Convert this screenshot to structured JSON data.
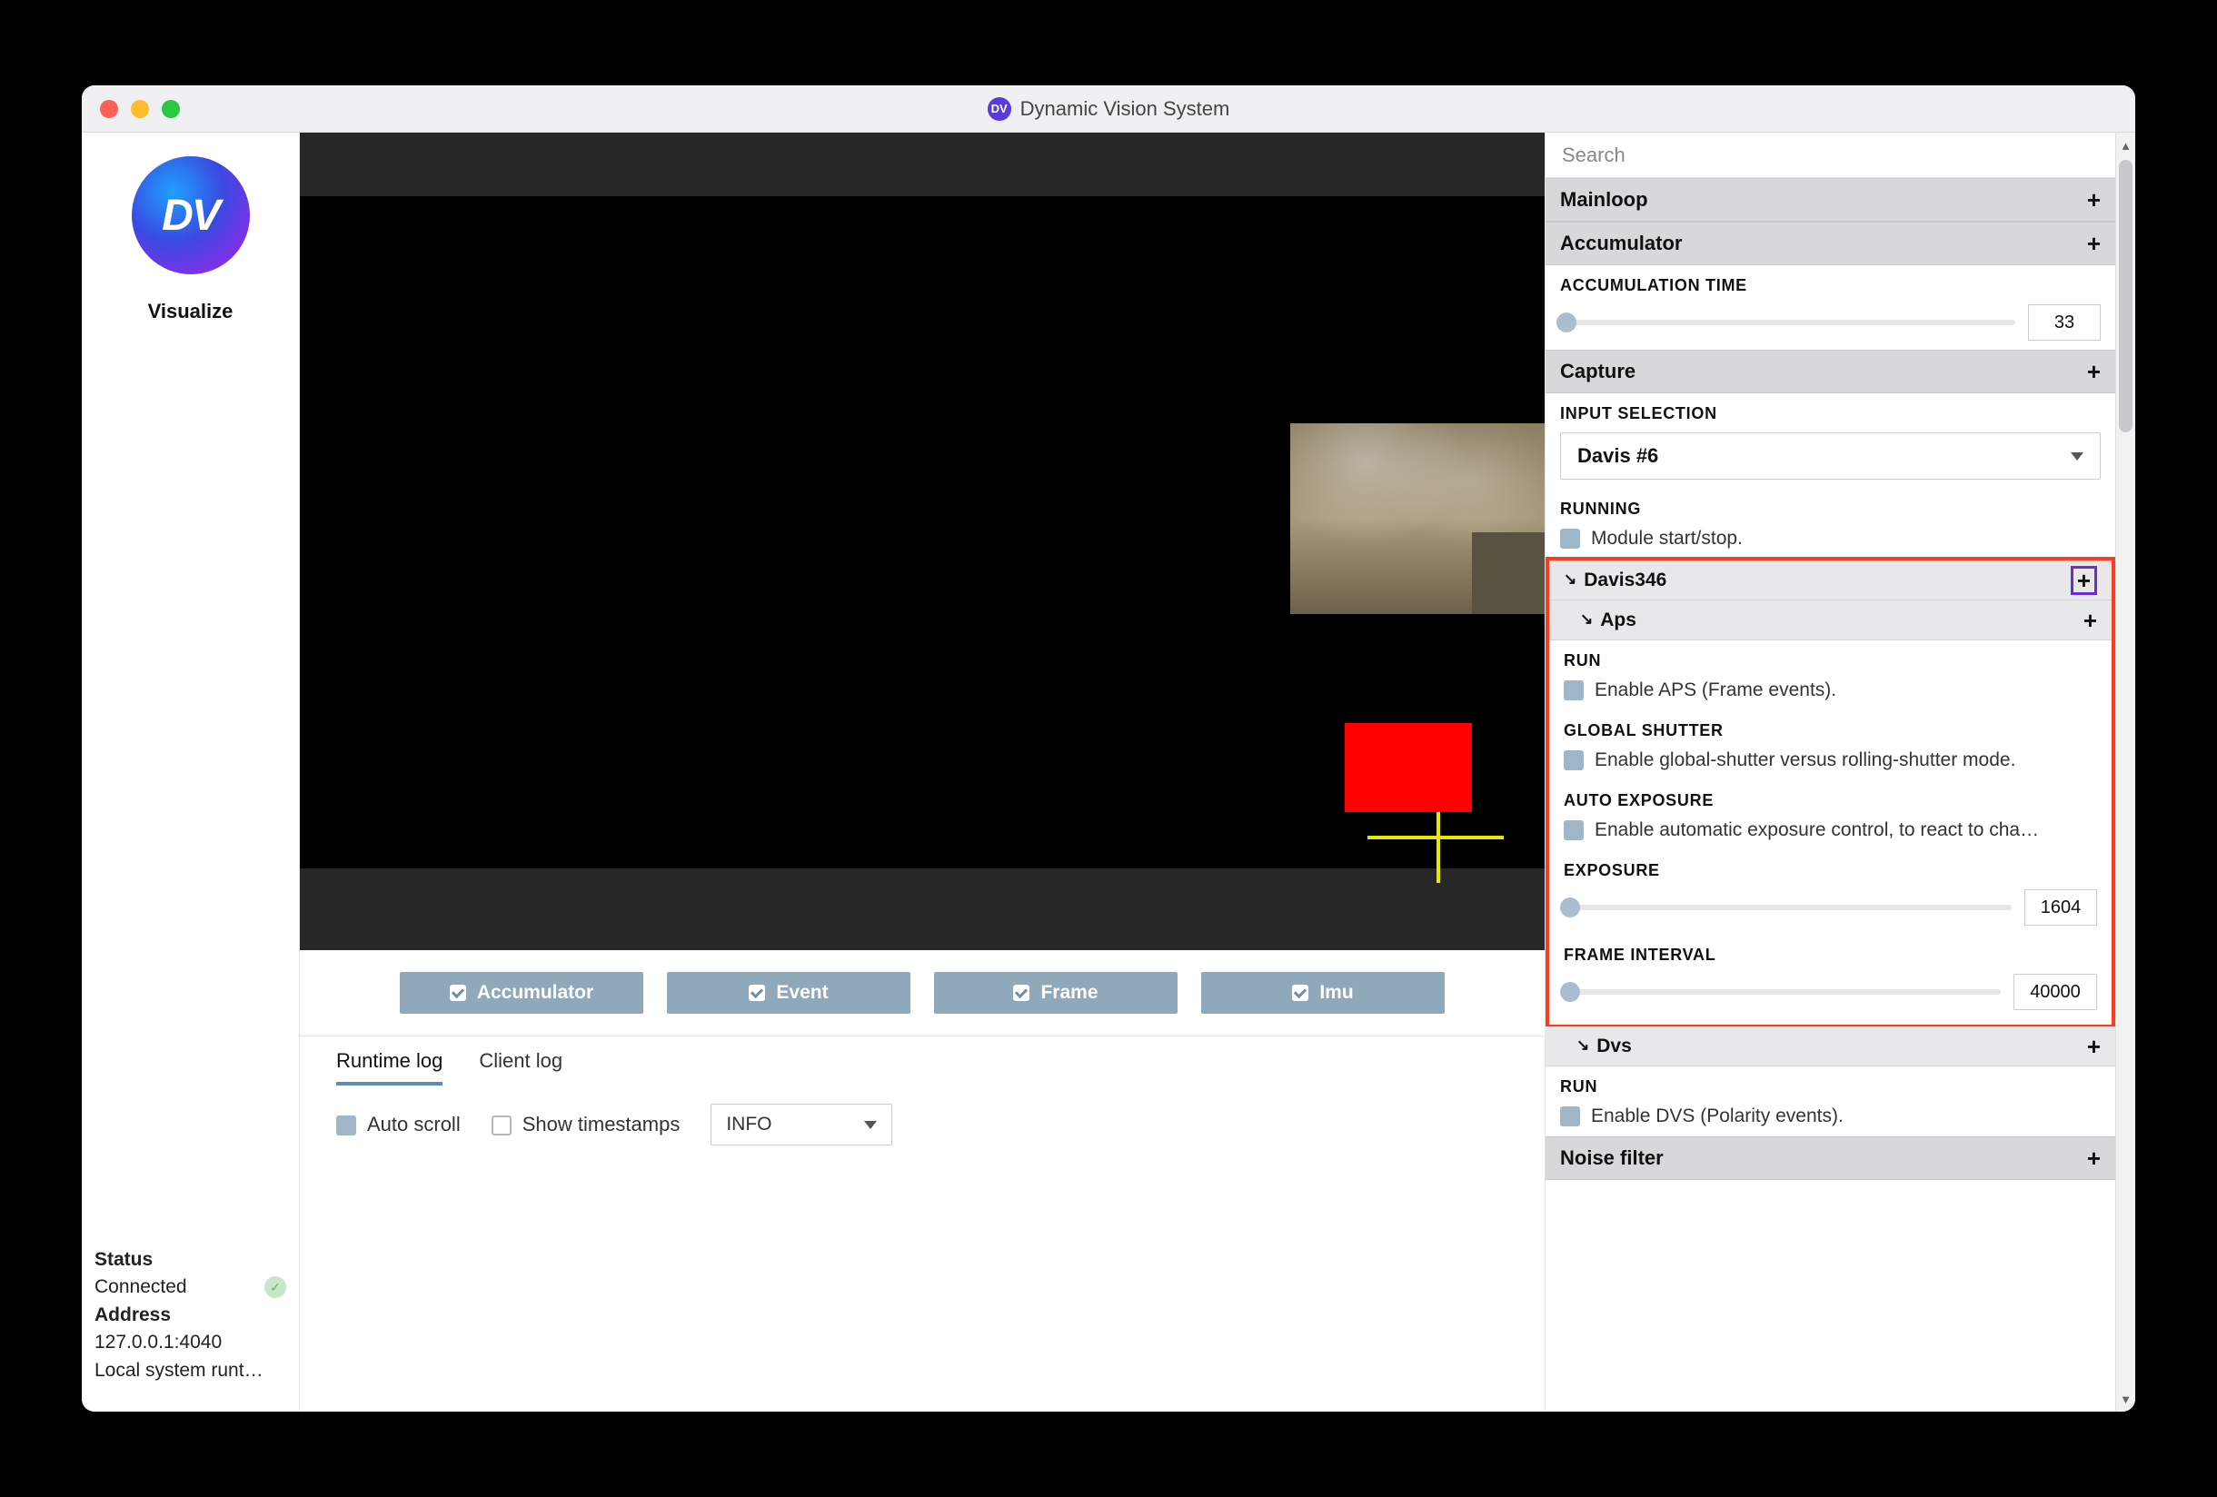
{
  "window": {
    "title": "Dynamic Vision System",
    "icon_text": "DV"
  },
  "left": {
    "logo_text": "DV",
    "visualize_label": "Visualize",
    "status_heading": "Status",
    "status_value": "Connected",
    "address_heading": "Address",
    "address_value": "127.0.0.1:4040",
    "system_line": "Local system runt…"
  },
  "tabs": {
    "accumulator": "Accumulator",
    "event": "Event",
    "frame": "Frame",
    "imu": "Imu"
  },
  "log": {
    "tab_runtime": "Runtime log",
    "tab_client": "Client log",
    "autoscroll": "Auto scroll",
    "show_ts": "Show timestamps",
    "level": "INFO"
  },
  "panel": {
    "search_placeholder": "Search",
    "mainloop": "Mainloop",
    "accumulator": "Accumulator",
    "accum_time_label": "ACCUMULATION TIME",
    "accum_time_value": "33",
    "capture": "Capture",
    "input_selection_label": "INPUT SELECTION",
    "input_selection_value": "Davis #6",
    "running_label": "RUNNING",
    "running_desc": "Module start/stop.",
    "davis346": "Davis346",
    "aps": "Aps",
    "run_label": "RUN",
    "aps_run_desc": "Enable APS (Frame events).",
    "global_shutter_label": "GLOBAL SHUTTER",
    "global_shutter_desc": "Enable global-shutter versus rolling-shutter mode.",
    "auto_exposure_label": "AUTO EXPOSURE",
    "auto_exposure_desc": "Enable automatic exposure control, to react to cha…",
    "exposure_label": "EXPOSURE",
    "exposure_value": "1604",
    "frame_interval_label": "FRAME INTERVAL",
    "frame_interval_value": "40000",
    "dvs": "Dvs",
    "dvs_run_desc": "Enable DVS (Polarity events).",
    "noise_filter": "Noise filter"
  }
}
